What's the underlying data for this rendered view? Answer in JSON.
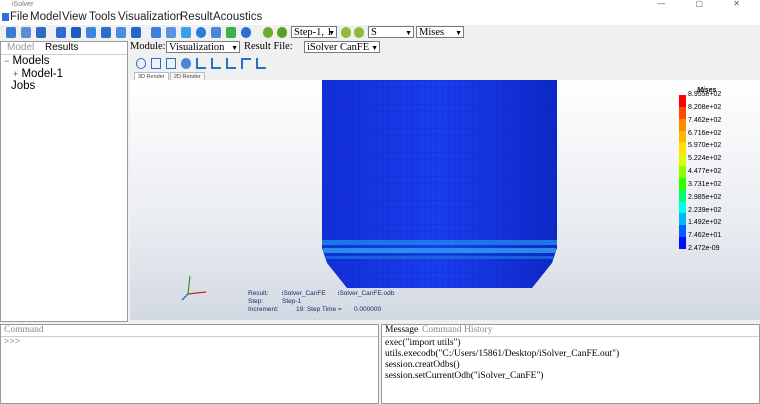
{
  "window": {
    "title": "iSolver",
    "controls": "— ▢ ✕"
  },
  "menu": [
    "File",
    "Model",
    "View",
    "Tools",
    "Visualization",
    "Result",
    "Acoustics"
  ],
  "toolbar": {
    "step": "Step-1, 1",
    "variable": "S",
    "component": "Mises"
  },
  "left_panel": {
    "tabs": [
      "Model",
      "Results"
    ],
    "tree": {
      "expander": "−",
      "child_expander": "+",
      "models": "Models",
      "model1": "Model-1",
      "jobs": "Jobs"
    }
  },
  "module_bar": {
    "module_label": "Module:",
    "module_value": "Visualization",
    "result_label": "Result File:",
    "result_value": "iSolver CanFE"
  },
  "render_tabs": [
    "3D Render",
    "2D Render"
  ],
  "legend": {
    "title": "Mises",
    "values": [
      "8.955e+02",
      "8.208e+02",
      "7.462e+02",
      "6.716e+02",
      "5.970e+02",
      "5.224e+02",
      "4.477e+02",
      "3.731e+02",
      "2.985e+02",
      "2.239e+02",
      "1.492e+02",
      "7.462e+01",
      "2.472e-09"
    ],
    "colors": [
      "#ff0000",
      "#ff4b00",
      "#ff8c00",
      "#ffb800",
      "#ffe000",
      "#d8ff00",
      "#8cff00",
      "#2dff00",
      "#00ff6e",
      "#00ffe8",
      "#00b8ff",
      "#0060ff",
      "#0010ff"
    ]
  },
  "info": {
    "result_label": "Result:",
    "result_value": "iSolver_CanFE",
    "file_value": "iSolver_CanFE.odb",
    "step_label": "Step:",
    "step_value": "Step-1",
    "increment_label": "Increment:",
    "increment_value": "19: Step Time =",
    "time_value": "0.000000"
  },
  "command": {
    "tab": "Command",
    "prompt": ">>>"
  },
  "message": {
    "tabs": [
      "Message",
      "Command History"
    ],
    "lines": [
      "exec(\"import utils\")",
      "utils.execodb(\"C:/Users/15861/Desktop/iSolver_CanFE.out\")",
      "session.creatOdbs()",
      "session.setCurrentOdb(\"iSolver_CanFE\")"
    ]
  }
}
